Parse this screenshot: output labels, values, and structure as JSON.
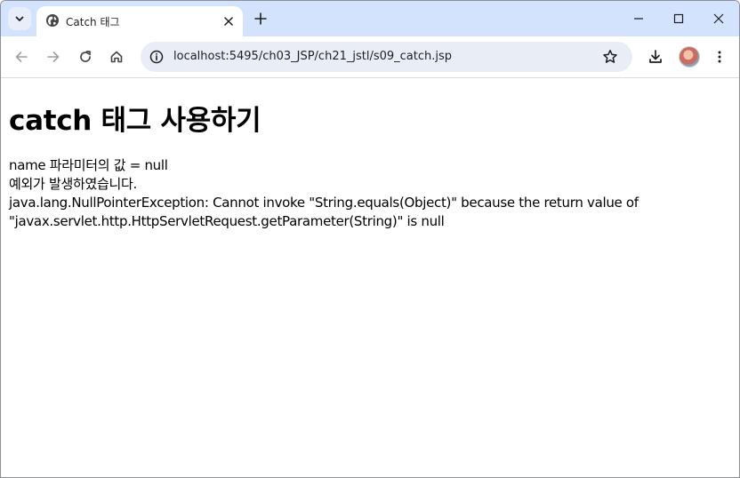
{
  "browser": {
    "tab": {
      "title": "Catch 태그",
      "favicon": "globe-icon"
    },
    "address_bar": {
      "url": "localhost:5495/ch03_JSP/ch21_jstl/s09_catch.jsp"
    },
    "colors": {
      "tabstrip": "#d3e3fd",
      "omnibox": "#e9eef6",
      "icon": "#474747"
    }
  },
  "page": {
    "heading": "catch 태그 사용하기",
    "lines": [
      "name 파라미터의 값 = null",
      "예외가 발생하였습니다.",
      "java.lang.NullPointerException: Cannot invoke \"String.equals(Object)\" because the return value of",
      "\"javax.servlet.http.HttpServletRequest.getParameter(String)\" is null"
    ]
  }
}
